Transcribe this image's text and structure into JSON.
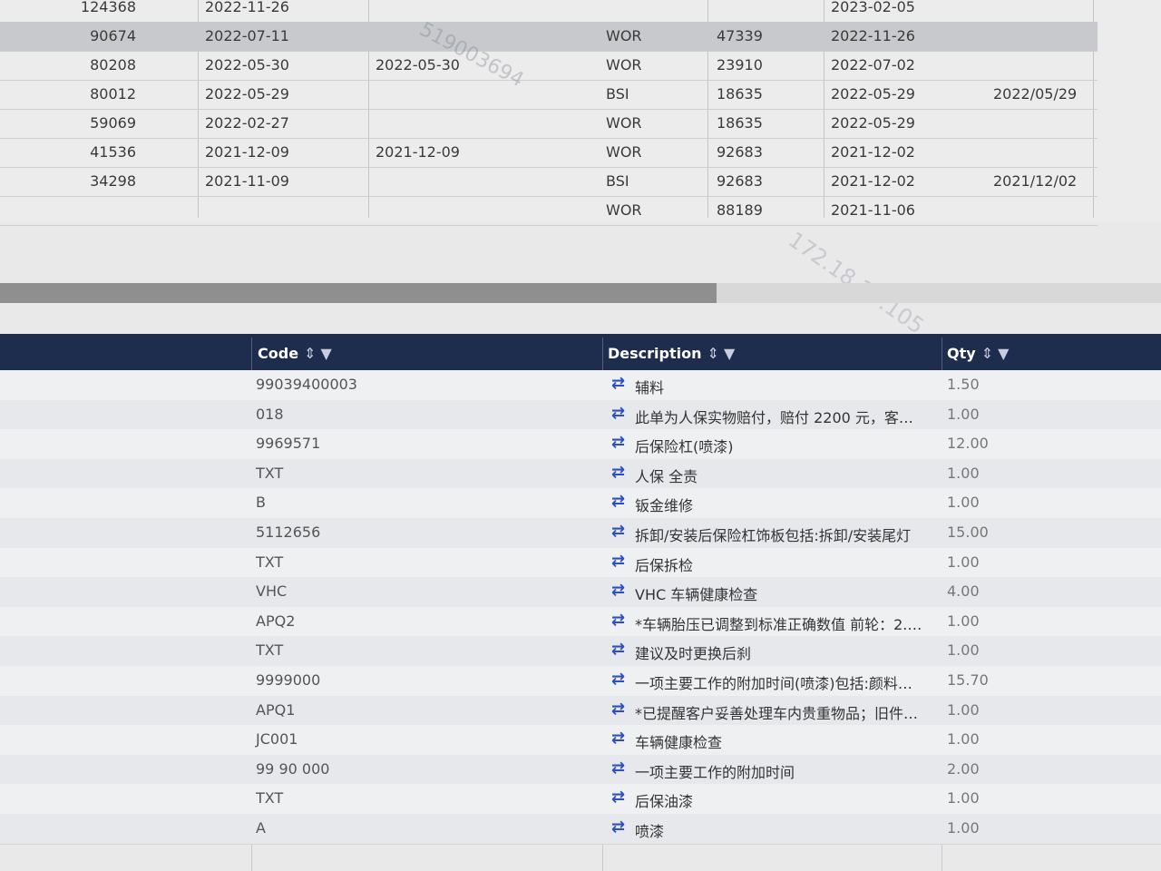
{
  "top_table": {
    "rows": [
      {
        "id": "124368",
        "date1": "2022-11-26",
        "date2": "",
        "type": "",
        "num": "",
        "date3": "2023-02-05",
        "date4": "",
        "selected": false
      },
      {
        "id": "90674",
        "date1": "2022-07-11",
        "date2": "",
        "type": "WOR",
        "num": "47339",
        "date3": "2022-11-26",
        "date4": "",
        "selected": true
      },
      {
        "id": "80208",
        "date1": "2022-05-30",
        "date2": "2022-05-30",
        "type": "WOR",
        "num": "23910",
        "date3": "2022-07-02",
        "date4": "",
        "selected": false
      },
      {
        "id": "80012",
        "date1": "2022-05-29",
        "date2": "",
        "type": "BSI",
        "num": "18635",
        "date3": "2022-05-29",
        "date4": "2022/05/29",
        "selected": false
      },
      {
        "id": "59069",
        "date1": "2022-02-27",
        "date2": "",
        "type": "WOR",
        "num": "18635",
        "date3": "2022-05-29",
        "date4": "",
        "selected": false
      },
      {
        "id": "41536",
        "date1": "2021-12-09",
        "date2": "2021-12-09",
        "type": "WOR",
        "num": "92683",
        "date3": "2021-12-02",
        "date4": "",
        "selected": false
      },
      {
        "id": "34298",
        "date1": "2021-11-09",
        "date2": "",
        "type": "BSI",
        "num": "92683",
        "date3": "2021-12-02",
        "date4": "2021/12/02",
        "selected": false
      },
      {
        "id": "",
        "date1": "",
        "date2": "",
        "type": "WOR",
        "num": "88189",
        "date3": "2021-11-06",
        "date4": "",
        "selected": false
      }
    ],
    "watermark_1": "519003694",
    "watermark_2": "172.18.17.105"
  },
  "bottom_table": {
    "columns": {
      "code": "Code",
      "description": "Description",
      "qty": "Qty"
    },
    "sort_filter_glyph": "⇕ ▼",
    "row_icon": "swap-arrows-icon",
    "rows": [
      {
        "code": "99039400003",
        "description": "辅料",
        "qty": "1.50"
      },
      {
        "code": "018",
        "description": "此单为人保实物赔付，赔付 2200 元，客户...",
        "qty": "1.00"
      },
      {
        "code": "9969571",
        "description": "后保险杠(喷漆)",
        "qty": "12.00"
      },
      {
        "code": "TXT",
        "description": "人保 全责",
        "qty": "1.00"
      },
      {
        "code": "B",
        "description": "钣金维修",
        "qty": "1.00"
      },
      {
        "code": "5112656",
        "description": "拆卸/安装后保险杠饰板包括:拆卸/安装尾灯",
        "qty": "15.00"
      },
      {
        "code": "TXT",
        "description": "后保拆检",
        "qty": "1.00"
      },
      {
        "code": "VHC",
        "description": "VHC 车辆健康检查",
        "qty": "4.00"
      },
      {
        "code": "APQ2",
        "description": "*车辆胎压已调整到标准正确数值 前轮：2.3...",
        "qty": "1.00"
      },
      {
        "code": "TXT",
        "description": "建议及时更换后刹",
        "qty": "1.00"
      },
      {
        "code": "9999000",
        "description": "一项主要工作的附加时间(喷漆)包括:颜料混...",
        "qty": "15.70"
      },
      {
        "code": "APQ1",
        "description": "*已提醒客户妥善处理车内贵重物品；旧件保...",
        "qty": "1.00"
      },
      {
        "code": "JC001",
        "description": "车辆健康检查",
        "qty": "1.00"
      },
      {
        "code": "99 90 000",
        "description": "一项主要工作的附加时间",
        "qty": "2.00"
      },
      {
        "code": "TXT",
        "description": "后保油漆",
        "qty": "1.00"
      },
      {
        "code": "A",
        "description": "喷漆",
        "qty": "1.00"
      }
    ]
  }
}
